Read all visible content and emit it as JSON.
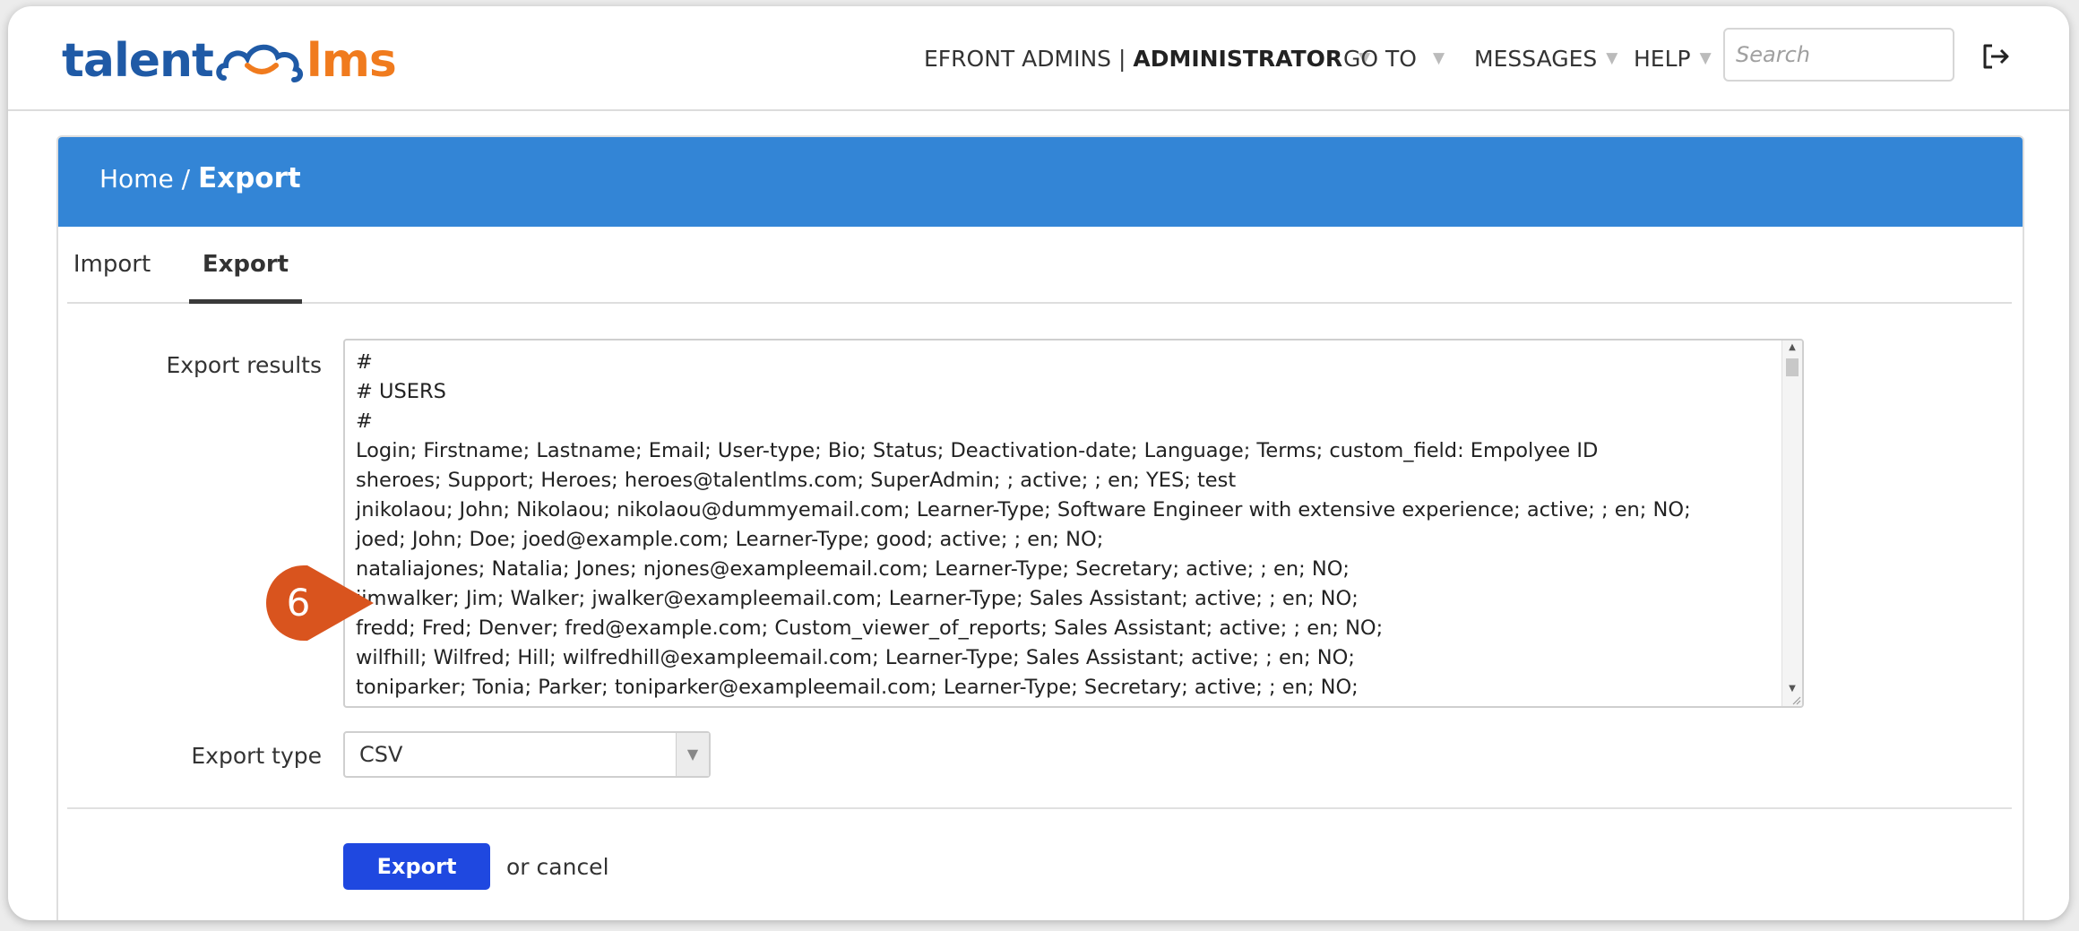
{
  "logo": {
    "left": "talent",
    "right": "lms"
  },
  "nav": {
    "user_prefix": "EFRONT ADMINS |",
    "user_role": "ADMINISTRATOR",
    "goto": "GO TO",
    "messages": "MESSAGES",
    "help": "HELP"
  },
  "search": {
    "placeholder": "Search"
  },
  "breadcrumb": {
    "home": "Home",
    "separator": "/",
    "current": "Export"
  },
  "tabs": [
    {
      "label": "Import",
      "active": false
    },
    {
      "label": "Export",
      "active": true
    }
  ],
  "form": {
    "results_label": "Export results",
    "results_text": "#\n# USERS\n#\nLogin; Firstname; Lastname; Email; User-type; Bio; Status; Deactivation-date; Language; Terms; custom_field: Empolyee ID\nsheroes; Support; Heroes; heroes@talentlms.com; SuperAdmin; ; active; ; en; YES; test\njnikolaou; John; Nikolaou; nikolaou@dummyemail.com; Learner-Type; Software Engineer with extensive experience; active; ; en; NO;\njoed; John; Doe; joed@example.com; Learner-Type; good; active; ; en; NO;\nnataliajones; Natalia; Jones; njones@exampleemail.com; Learner-Type; Secretary; active; ; en; NO;\njimwalker; Jim; Walker; jwalker@exampleemail.com; Learner-Type; Sales Assistant; active; ; en; NO;\nfredd; Fred; Denver; fred@example.com; Custom_viewer_of_reports; Sales Assistant; active; ; en; NO;\nwilfhill; Wilfred; Hill; wilfredhill@exampleemail.com; Learner-Type; Sales Assistant; active; ; en; NO;\ntoniparker; Tonia; Parker; toniparker@exampleemail.com; Learner-Type; Secretary; active; ; en; NO;",
    "type_label": "Export type",
    "type_value": "CSV",
    "submit_label": "Export",
    "or_text": "or",
    "cancel_label": "cancel"
  },
  "step_badge": {
    "number": "6",
    "color": "#d9541e"
  },
  "colors": {
    "header_blue": "#3385d6",
    "button_blue": "#1f48e0",
    "logo_blue": "#1f5aa6",
    "logo_orange": "#f07b1e"
  }
}
